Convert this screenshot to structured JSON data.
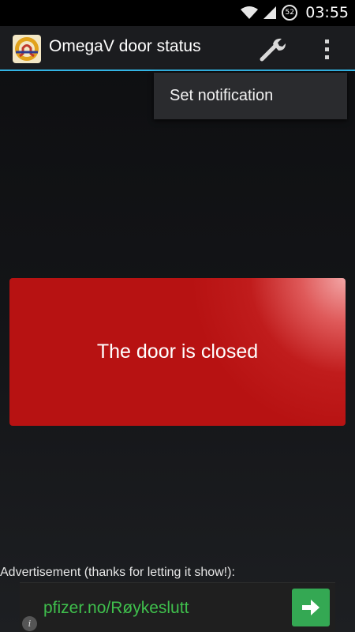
{
  "status_bar": {
    "time": "03:55",
    "battery_level": "52",
    "icons": [
      "wifi-icon",
      "signal-icon",
      "battery-icon"
    ]
  },
  "action_bar": {
    "title": "OmegaV door status",
    "icons": [
      "app-logo-icon",
      "wrench-icon",
      "overflow-menu-icon"
    ]
  },
  "menu": {
    "items": [
      {
        "label": "Set notification"
      }
    ]
  },
  "door": {
    "status_text": "The door is closed",
    "color": "#b71212"
  },
  "advertisement": {
    "caption": "Advertisement (thanks for letting it show!):",
    "link_text": "pfizer.no/Røykeslutt",
    "link_color": "#3fbf4c",
    "button_icon": "arrow-right-icon",
    "info_icon": "info-icon"
  },
  "colors": {
    "accent": "#33b5e5",
    "background": "#101114"
  }
}
